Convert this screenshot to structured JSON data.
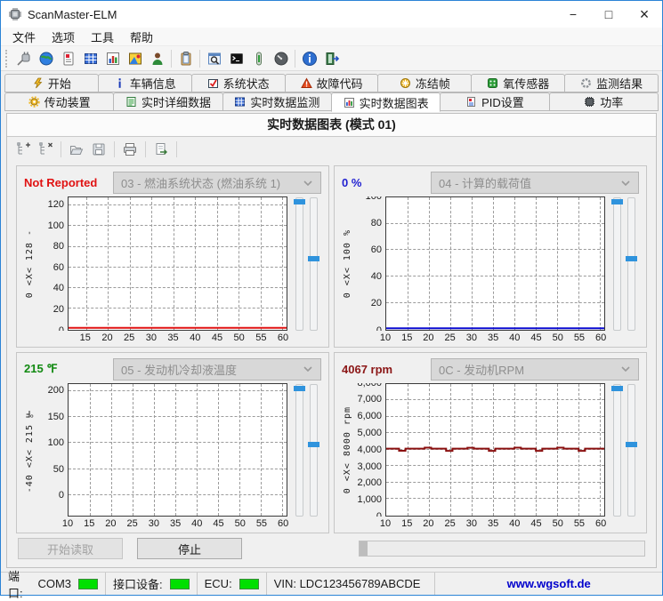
{
  "window": {
    "title": "ScanMaster-ELM",
    "minimize": "−",
    "maximize": "□",
    "close": "×"
  },
  "menu": {
    "items": [
      {
        "label": "文件"
      },
      {
        "label": "选项"
      },
      {
        "label": "工具"
      },
      {
        "label": "帮助"
      }
    ]
  },
  "toolbar": {
    "icons": [
      "plug",
      "globe",
      "report",
      "grid",
      "bar-chart",
      "dashboard",
      "user",
      "clipboard",
      "search",
      "terminal",
      "thermometer",
      "gauge",
      "info",
      "exit"
    ]
  },
  "tabs": {
    "row1": [
      {
        "label": "开始"
      },
      {
        "label": "车辆信息"
      },
      {
        "label": "系统状态"
      },
      {
        "label": "故障代码"
      },
      {
        "label": "冻结帧"
      },
      {
        "label": "氧传感器"
      },
      {
        "label": "监测结果"
      }
    ],
    "row2": [
      {
        "label": "传动装置"
      },
      {
        "label": "实时详细数据"
      },
      {
        "label": "实时数据监测"
      },
      {
        "label": "实时数据图表"
      },
      {
        "label": "PID设置"
      },
      {
        "label": "功率"
      }
    ],
    "active": "实时数据图表"
  },
  "page_title": "实时数据图表 (模式 01)",
  "chart_toolbar": {
    "icons": [
      "add-pid",
      "remove-pid",
      "open",
      "save",
      "print",
      "export"
    ]
  },
  "panels": [
    {
      "value": "Not Reported",
      "value_color": "#e01212",
      "selector": "03 - 燃油系统状态 (燃油系统 1)",
      "axis_label": "0 <X< 128 -",
      "chart": {
        "type": "line",
        "xlim": [
          11,
          61
        ],
        "ylim": [
          0,
          128
        ],
        "xticks": [
          15,
          20,
          25,
          30,
          35,
          40,
          45,
          50,
          55,
          60
        ],
        "yticks": [
          {
            "v": 0,
            "label": "0"
          },
          {
            "v": 20,
            "label": "20"
          },
          {
            "v": 40,
            "label": "40"
          },
          {
            "v": 60,
            "label": "60"
          },
          {
            "v": 80,
            "label": "80"
          },
          {
            "v": 100,
            "label": "100"
          },
          {
            "v": 120,
            "label": "120"
          }
        ],
        "series": [
          {
            "name": "fuel-system-status",
            "color": "#e01212",
            "width": 2,
            "x": [
              11,
              61
            ],
            "y": [
              1.5,
              1.5
            ]
          }
        ]
      }
    },
    {
      "value": "0 %",
      "value_color": "#1f1fd0",
      "selector": "04 - 计算的载荷值",
      "axis_label": "0 <X< 100 %",
      "chart": {
        "type": "line",
        "xlim": [
          10,
          61
        ],
        "ylim": [
          0,
          100
        ],
        "xticks": [
          10,
          15,
          20,
          25,
          30,
          35,
          40,
          45,
          50,
          55,
          60
        ],
        "yticks": [
          {
            "v": 0,
            "label": "0"
          },
          {
            "v": 20,
            "label": "20"
          },
          {
            "v": 40,
            "label": "40"
          },
          {
            "v": 60,
            "label": "60"
          },
          {
            "v": 80,
            "label": "80"
          },
          {
            "v": 100,
            "label": "100"
          }
        ],
        "series": [
          {
            "name": "calculated-load",
            "color": "#0a0ad0",
            "width": 2,
            "x": [
              10,
              61
            ],
            "y": [
              0.8,
              0.8
            ]
          }
        ]
      }
    },
    {
      "value": "215 ℉",
      "value_color": "#128a12",
      "selector": "05 - 发动机冷却液温度",
      "axis_label": "-40 <X< 215 ℉",
      "chart": {
        "type": "line",
        "xlim": [
          10,
          61
        ],
        "ylim": [
          -40,
          215
        ],
        "xticks": [
          10,
          15,
          20,
          25,
          30,
          35,
          40,
          45,
          50,
          55,
          60
        ],
        "yticks": [
          {
            "v": 0,
            "label": "0"
          },
          {
            "v": 50,
            "label": "50"
          },
          {
            "v": 100,
            "label": "100"
          },
          {
            "v": 150,
            "label": "150"
          },
          {
            "v": 200,
            "label": "200"
          }
        ],
        "series": []
      }
    },
    {
      "value": "4067 rpm",
      "value_color": "#8b1616",
      "selector": "0C - 发动机RPM",
      "axis_label": "0 <X< 8000 rpm",
      "chart": {
        "type": "line",
        "xlim": [
          10,
          61
        ],
        "ylim": [
          0,
          8000
        ],
        "xticks": [
          10,
          15,
          20,
          25,
          30,
          35,
          40,
          45,
          50,
          55,
          60
        ],
        "yticks": [
          {
            "v": 0,
            "label": "0"
          },
          {
            "v": 1000,
            "label": "1,000"
          },
          {
            "v": 2000,
            "label": "2,000"
          },
          {
            "v": 3000,
            "label": "3,000"
          },
          {
            "v": 4000,
            "label": "4,000"
          },
          {
            "v": 5000,
            "label": "5,000"
          },
          {
            "v": 6000,
            "label": "6,000"
          },
          {
            "v": 7000,
            "label": "7,000"
          },
          {
            "v": 8000,
            "label": "8,000"
          }
        ],
        "series": [
          {
            "name": "engine-rpm",
            "color": "#8b1010",
            "width": 2,
            "x": [
              10,
              13,
              13,
              14.5,
              14.5,
              19,
              19,
              20.5,
              20.5,
              24,
              24,
              25.5,
              25.5,
              29,
              29,
              30.5,
              30.5,
              34,
              34,
              35.5,
              35.5,
              40,
              40,
              41.5,
              41.5,
              45,
              45,
              46.5,
              46.5,
              50,
              50,
              51.5,
              51.5,
              55,
              55,
              56.5,
              56.5,
              61
            ],
            "y": [
              4090,
              4090,
              3960,
              3960,
              4090,
              4090,
              4150,
              4150,
              4090,
              4090,
              3950,
              3950,
              4090,
              4090,
              4140,
              4140,
              4090,
              4090,
              3955,
              3955,
              4090,
              4090,
              4150,
              4150,
              4090,
              4090,
              3950,
              3950,
              4090,
              4090,
              4145,
              4145,
              4090,
              4090,
              3955,
              3955,
              4090,
              4090
            ]
          }
        ]
      }
    }
  ],
  "buttons": {
    "start": "开始读取",
    "stop": "停止"
  },
  "statusbar": {
    "port_label": "端口:",
    "port_value": "COM3",
    "interface_label": "接口设备:",
    "ecu_label": "ECU:",
    "vin": "VIN: LDC123456789ABCDE",
    "website": "www.wgsoft.de",
    "website_color": "#0000cc"
  }
}
